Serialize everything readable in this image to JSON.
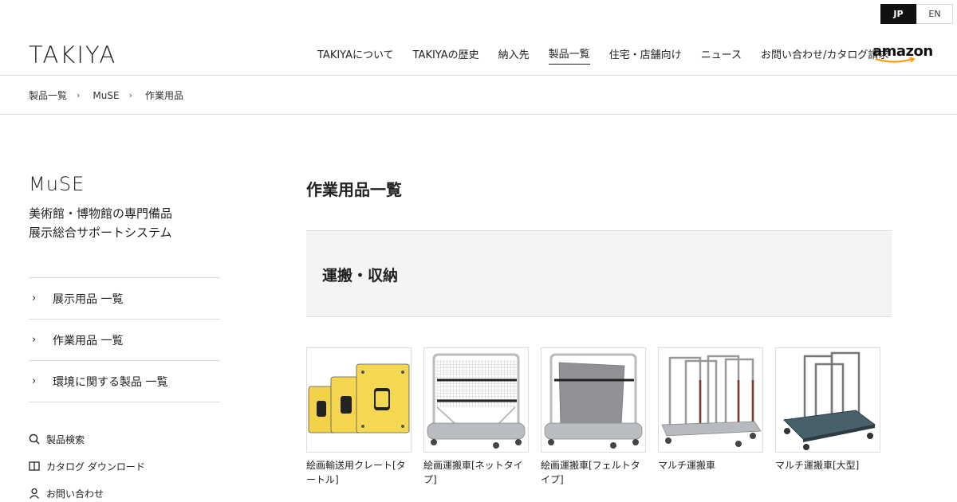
{
  "lang": {
    "jp": "JP",
    "en": "EN"
  },
  "header": {
    "logo": "TAKIYA",
    "nav": [
      "TAKIYAについて",
      "TAKIYAの歴史",
      "納入先",
      "製品一覧",
      "住宅・店舗向け",
      "ニュース",
      "お問い合わせ/カタログ請求"
    ],
    "active_nav": "製品一覧",
    "amazon": "amazon"
  },
  "breadcrumb": [
    "製品一覧",
    "MuSE",
    "作業用品"
  ],
  "sidebar": {
    "title": "MuSE",
    "subtitle_line1": "美術館・博物館の専門備品",
    "subtitle_line2": "展示総合サポートシステム",
    "menu": [
      "展示用品 一覧",
      "作業用品 一覧",
      "環境に関する製品 一覧"
    ],
    "links": [
      {
        "label": "製品検索",
        "icon": "search-icon"
      },
      {
        "label": "カタログ ダウンロード",
        "icon": "book-icon"
      },
      {
        "label": "お問い合わせ",
        "icon": "person-icon"
      }
    ]
  },
  "main": {
    "title": "作業用品一覧",
    "section": "運搬・収納",
    "products": [
      {
        "name": "絵画輸送用クレート[タートル]"
      },
      {
        "name": "絵画運搬車[ネットタイプ]"
      },
      {
        "name": "絵画運搬車[フェルトタイプ]"
      },
      {
        "name": "マルチ運搬車"
      },
      {
        "name": "マルチ運搬車[大型]"
      }
    ]
  },
  "colors": {
    "active_lang_bg": "#111111",
    "section_bg": "#f4f4f4",
    "amazon_smile": "#f90"
  }
}
